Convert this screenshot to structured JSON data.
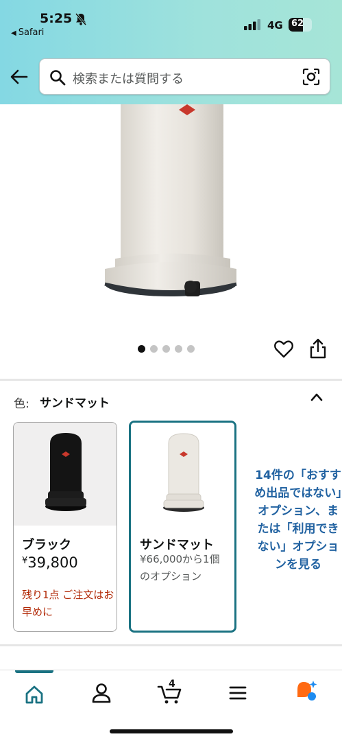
{
  "status_bar": {
    "time": "5:25",
    "back_app": "Safari",
    "network": "4G",
    "battery": "62",
    "battery_level": 0.62
  },
  "search": {
    "placeholder": "検索または質問する"
  },
  "gallery": {
    "image_count": 5,
    "active_index": 0
  },
  "color_selector": {
    "label": "色:",
    "selected": "サンドマット",
    "options": [
      {
        "name": "ブラック",
        "currency": "¥",
        "price": "39,800",
        "stock_note": "残り1点 ご注文はお早めに",
        "selected": false
      },
      {
        "name": "サンドマット",
        "options_note": "¥66,000から1個のオプション",
        "selected": true
      }
    ],
    "more_link": "14件の「おすすめ出品ではない」オプション、または「利用できない」オプションを見る"
  },
  "tabbar": {
    "cart_count": "4",
    "active_tab": "home"
  },
  "colors": {
    "accent": "#1a7282",
    "link": "#2162a1",
    "stock_warning": "#b12704",
    "header_gradient_start": "#84d8e3",
    "header_gradient_end": "#a6e5d7",
    "alexa_orange": "#ff6a13",
    "alexa_blue": "#1e8cf0"
  }
}
